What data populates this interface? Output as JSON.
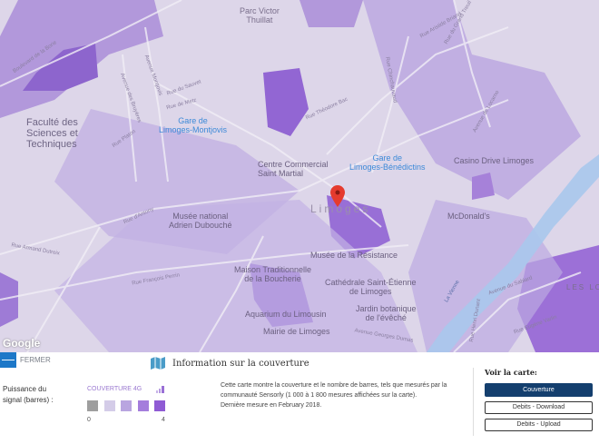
{
  "map": {
    "city_label": "Limoges",
    "places": [
      {
        "name": "Parc Victor\nThuillat",
        "type": "park"
      },
      {
        "name": "Faculté des\nSciences et\nTechniques",
        "type": "area"
      },
      {
        "name": "Gare de\nLimoges-Montjovis",
        "type": "transit"
      },
      {
        "name": "Centre Commercial\nSaint Martial",
        "type": "poi"
      },
      {
        "name": "Gare de\nLimoges-Bénédictins",
        "type": "transit"
      },
      {
        "name": "Casino Drive Limoges",
        "type": "poi"
      },
      {
        "name": "McDonald's",
        "type": "poi"
      },
      {
        "name": "Musée national\nAdrien Dubouché",
        "type": "poi"
      },
      {
        "name": "Maison Traditionnelle\nde la Boucherie",
        "type": "poi"
      },
      {
        "name": "Musée de la Résistance",
        "type": "poi"
      },
      {
        "name": "Cathédrale Saint-Étienne\nde Limoges",
        "type": "poi"
      },
      {
        "name": "Jardin botanique\nde l'évêché",
        "type": "poi"
      },
      {
        "name": "Aquarium du Limousin",
        "type": "poi"
      },
      {
        "name": "Mairie de Limoges",
        "type": "poi"
      },
      {
        "name": "LES LO",
        "type": "area"
      }
    ],
    "streets": [
      "Boulevard de la Borie",
      "Avenue Montjovis",
      "Avenue des Bruyères",
      "Rue Platon",
      "Rue du Sauvet",
      "Rue de Metz",
      "Rue Théodore Bac",
      "Rue Aristide Briand",
      "Rue du Grand Treuil",
      "Avenue de Locarno",
      "Rue d'Antony",
      "Rue Armand Dutreix",
      "Rue François Perrin",
      "La Vienne",
      "Avenue du Sablard",
      "Rue Henri Dunant",
      "Avenue Georges Dumas",
      "Rue Eugène Varlin",
      "Rue Chinchauvaud"
    ],
    "attribution": "Google"
  },
  "panel": {
    "close_label": "FERMER",
    "signal_label": "Puissance du signal (barres) :",
    "coverage_title": "COUVERTURE 4G",
    "scale_min": "0",
    "scale_max": "4",
    "scale_colors": [
      "#9e9e9e",
      "#d4cce8",
      "#b9a5e0",
      "#a47ddc",
      "#8f5bd4"
    ],
    "info_title": "Information sur la couverture",
    "info_line1": "Cette carte montre la couverture et le nombre de barres, tels que mesurés par la communauté Sensorly (1 000 à 1 800 mesures affichées sur la carte).",
    "info_line2": "Dernière mesure en February 2018.",
    "voir_label": "Voir la carte:",
    "buttons": [
      "Couverture",
      "Debits - Download",
      "Debits - Upload"
    ]
  }
}
